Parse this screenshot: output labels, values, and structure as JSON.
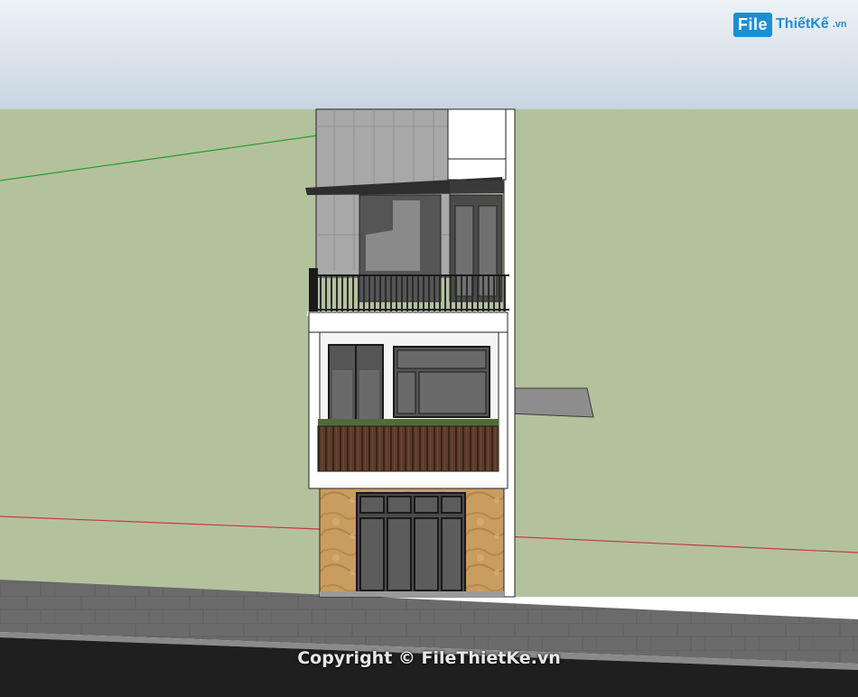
{
  "watermark": {
    "logo_box": "File",
    "logo_name": "ThiếtKế",
    "logo_tld": ".vn",
    "copyright": "Copyright © FileThietKe.vn"
  },
  "colors": {
    "sky_top": "#e9eef3",
    "sky_bottom": "#c9d6e2",
    "ground": "#b3c09c",
    "road": "#646464",
    "wall_white": "#ffffff",
    "stone": "#c59a5d",
    "wood": "#5a3a2a",
    "accent_blue": "#1a8fd6"
  }
}
